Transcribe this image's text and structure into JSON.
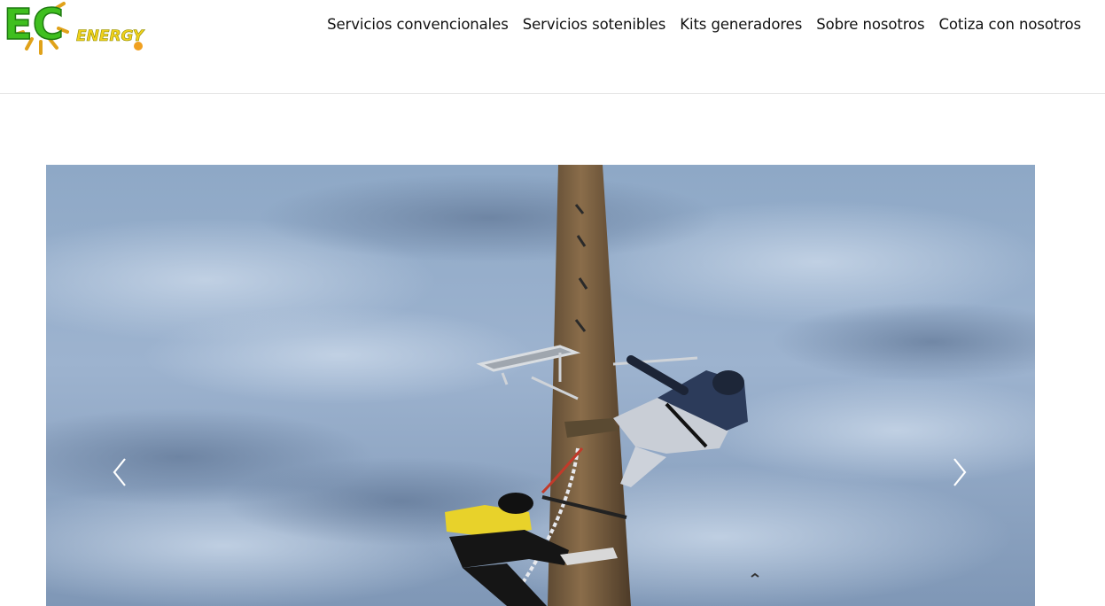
{
  "brand": {
    "logo_letters": "EC",
    "logo_word": "ENERGY",
    "colors": {
      "green": "#3fbf1f",
      "yellow": "#f2d21c",
      "orange": "#f0a020"
    }
  },
  "nav": {
    "items": [
      {
        "label": "Servicios convencionales"
      },
      {
        "label": "Servicios sotenibles"
      },
      {
        "label": "Kits generadores"
      },
      {
        "label": "Sobre nosotros"
      },
      {
        "label": "Cotiza con nosotros"
      }
    ]
  },
  "carousel": {
    "slide_description_icon": "photo-slide",
    "prev_icon": "chevron-left-icon",
    "next_icon": "chevron-right-icon"
  }
}
